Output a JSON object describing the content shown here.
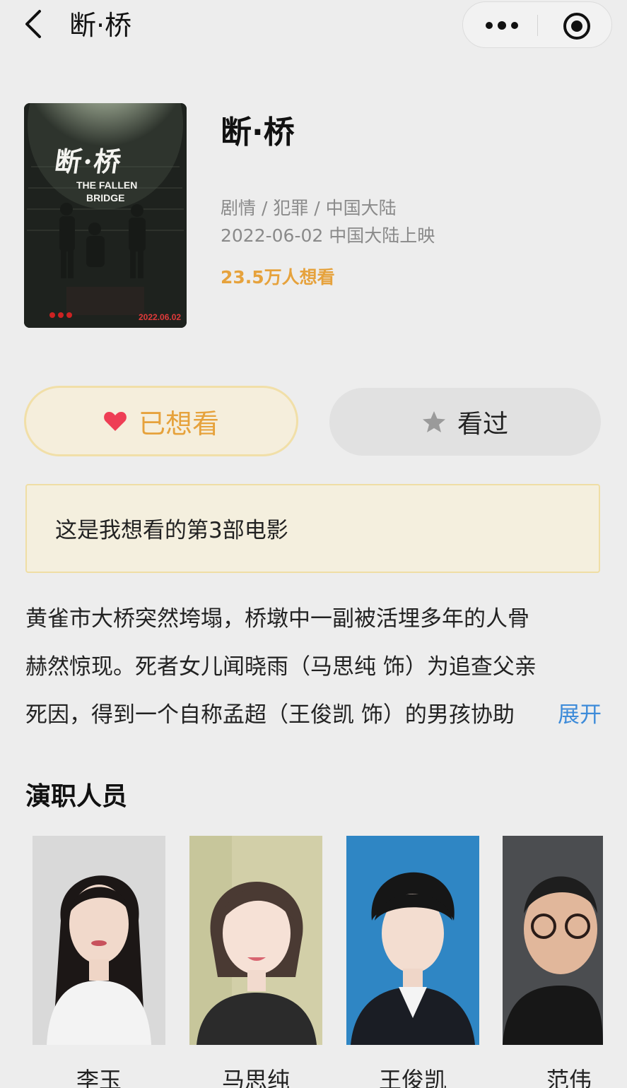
{
  "nav": {
    "title": "断·桥"
  },
  "movie": {
    "title": "断·桥",
    "genres": "剧情 / 犯罪 / 中国大陆",
    "release": "2022-06-02 中国大陆上映",
    "want_count": "23.5万人想看",
    "poster": {
      "title_cn": "断·桥",
      "title_en_1": "THE FALLEN",
      "title_en_2": "BRIDGE",
      "date": "2022.06.02"
    }
  },
  "actions": {
    "want_label": "已想看",
    "seen_label": "看过"
  },
  "note": "这是我想看的第3部电影",
  "synopsis": {
    "line1": "黄雀市大桥突然垮塌，桥墩中一副被活埋多年的人骨",
    "line2": "赫然惊现。死者女儿闻晓雨（马思纯 饰）为追查父亲",
    "line3": "死因，得到一个自称孟超（王俊凯 饰）的男孩协助",
    "expand": "展开"
  },
  "cast_heading": "演职人员",
  "cast": [
    {
      "name": "李玉"
    },
    {
      "name": "马思纯"
    },
    {
      "name": "王俊凯"
    },
    {
      "name": "范伟"
    }
  ],
  "colors": {
    "accent": "#e6a23c",
    "heart": "#ee3e55",
    "link": "#3d8bd9",
    "background": "#ededed"
  },
  "icons": {
    "back": "chevron-left-icon",
    "more": "more-dots-icon",
    "close": "target-circle-icon",
    "want": "heart-icon",
    "seen": "star-icon"
  }
}
